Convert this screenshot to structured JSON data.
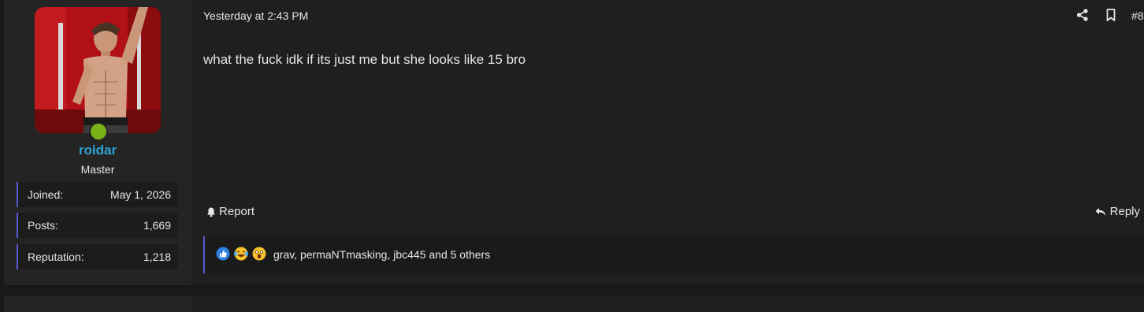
{
  "user": {
    "username": "roidar",
    "title": "Master",
    "online_color": "#7ab317",
    "stats": [
      {
        "label": "Joined:",
        "value": "May 1, 2026"
      },
      {
        "label": "Posts:",
        "value": "1,669"
      },
      {
        "label": "Reputation:",
        "value": "1,218"
      }
    ]
  },
  "post": {
    "timestamp": "Yesterday at 2:43 PM",
    "number": "#8",
    "body": "what the fuck idk if its just me but she looks like 15 bro",
    "actions": {
      "report": "Report",
      "reply": "Reply"
    },
    "reactions": {
      "icons": [
        "like-icon",
        "laugh-icon",
        "wow-icon"
      ],
      "text": "grav, permaNTmasking, jbc445 and 5 others"
    }
  },
  "colors": {
    "username": "#2fa2d6",
    "accent": "#5a5bd6",
    "background": "#191919",
    "panel": "#1f1f1f"
  }
}
